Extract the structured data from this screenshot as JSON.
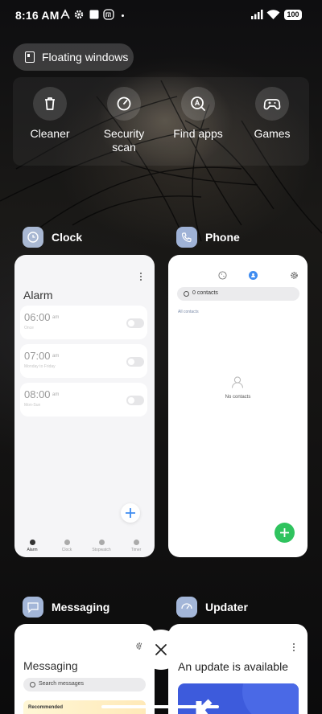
{
  "status_bar": {
    "time": "8:16 AM",
    "battery": "100"
  },
  "floating_windows": {
    "label": "Floating windows"
  },
  "tools": [
    {
      "label": "Cleaner",
      "icon": "trash-icon"
    },
    {
      "label": "Security scan",
      "icon": "speedometer-icon"
    },
    {
      "label": "Find apps",
      "icon": "find-apps-icon"
    },
    {
      "label": "Games",
      "icon": "gamepad-icon"
    }
  ],
  "apps": {
    "clock": {
      "name": "Clock",
      "title": "Alarm",
      "alarms": [
        {
          "time": "06:00",
          "ampm": "am",
          "sub": "Once"
        },
        {
          "time": "07:00",
          "ampm": "am",
          "sub": "Monday to Friday"
        },
        {
          "time": "08:00",
          "ampm": "am",
          "sub": "Mon-Sun"
        }
      ],
      "tabs": [
        "Alarm",
        "Clock",
        "Stopwatch",
        "Timer"
      ],
      "accent": "#3f8cf0"
    },
    "phone": {
      "name": "Phone",
      "search": "0 contacts",
      "filter": "All contacts",
      "empty": "No contacts",
      "accent": "#2fc35e"
    },
    "messaging": {
      "name": "Messaging",
      "title": "Messaging",
      "search": "Search messages",
      "section": "Recommended"
    },
    "updater": {
      "name": "Updater",
      "title": "An update is available",
      "banner": "#3d5bdc"
    }
  }
}
